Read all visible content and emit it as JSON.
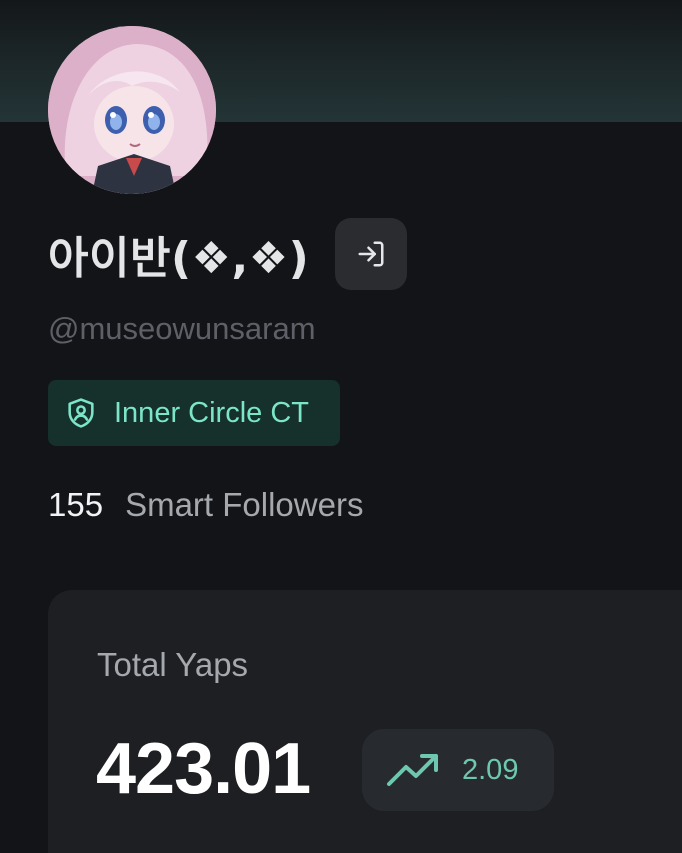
{
  "profile": {
    "display_name": "아이반(❖,❖)",
    "handle": "@museowunsaram",
    "avatar_icon": "anime-character-avatar",
    "login_icon": "log-in-icon"
  },
  "badge": {
    "label": "Inner Circle CT",
    "icon": "shield-user-icon",
    "color": "#7ce5c8"
  },
  "followers": {
    "count": "155",
    "label": "Smart Followers"
  },
  "yaps": {
    "title": "Total Yaps",
    "value": "423.01",
    "change": "2.09",
    "trend_icon": "trending-up-icon",
    "trend_color": "#6ec7b0"
  }
}
